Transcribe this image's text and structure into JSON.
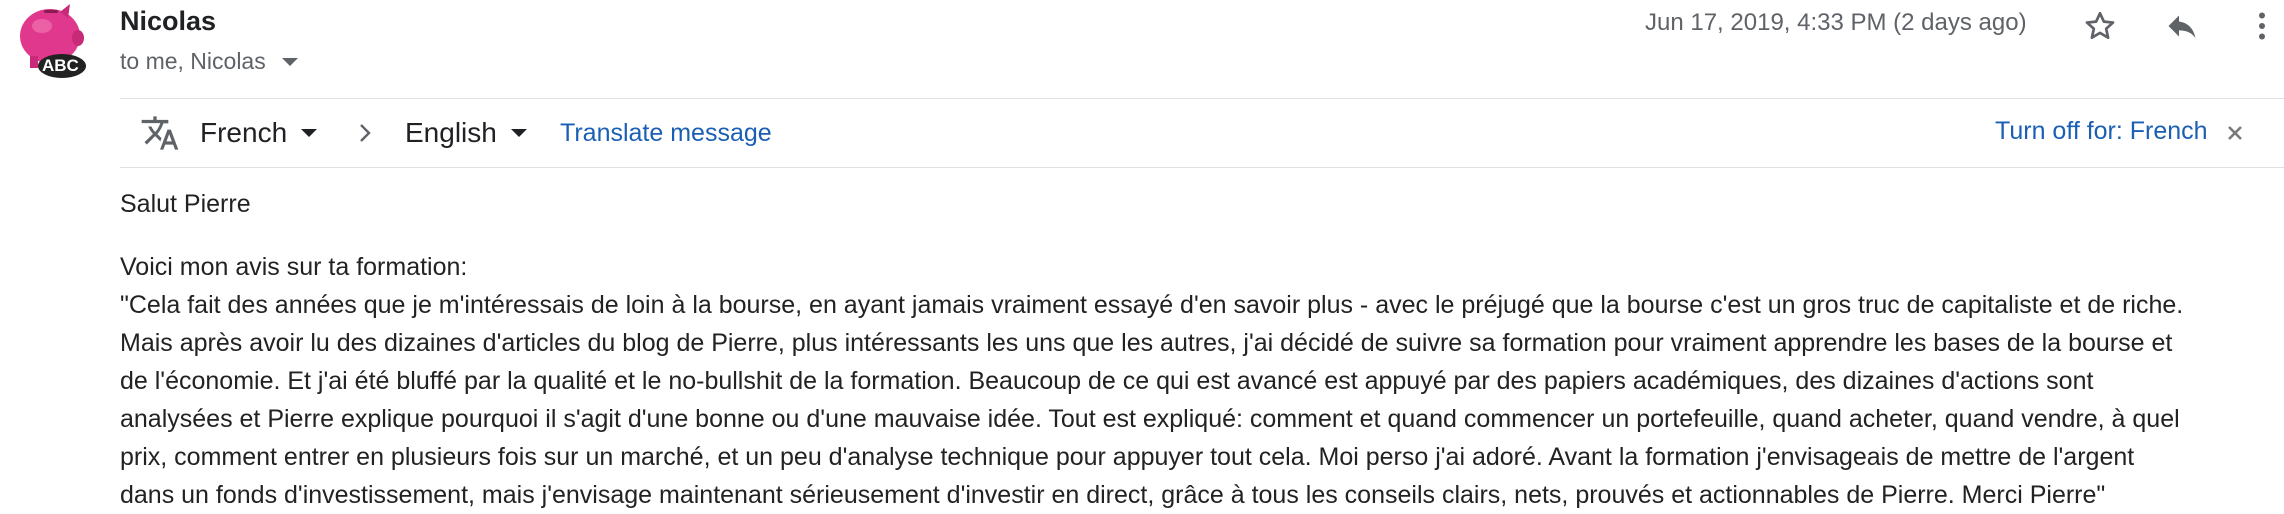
{
  "sender": {
    "name": "Nicolas",
    "avatar_text": "ABC",
    "recipients": "to me, Nicolas"
  },
  "header": {
    "date": "Jun 17, 2019, 4:33 PM (2 days ago)",
    "icons": [
      "star-icon",
      "reply-icon",
      "more-vert-icon"
    ]
  },
  "translate": {
    "icon": "translate-icon",
    "source_lang": "French",
    "target_lang": "English",
    "translate_link": "Translate message",
    "turn_off": "Turn off for: French",
    "link_color": "#1a5fb4"
  },
  "message": {
    "greeting": "Salut Pierre",
    "intro": "Voici mon avis sur ta formation:",
    "lines": [
      "\"Cela fait des années que je m'intéressais de loin à la bourse, en ayant jamais vraiment essayé d'en savoir plus - avec le préjugé que la bourse c'est un gros truc de capitaliste et de riche.",
      "Mais après avoir lu des dizaines d'articles du blog de Pierre, plus intéressants les uns que les autres, j'ai décidé de suivre sa formation pour vraiment apprendre les bases de la bourse et",
      "de l'économie. Et j'ai été bluffé par la qualité et le no-bullshit de la formation. Beaucoup de ce qui est avancé est appuyé par des papiers académiques, des dizaines d'actions sont",
      "analysées et Pierre explique pourquoi il s'agit d'une bonne ou d'une mauvaise idée. Tout est expliqué: comment et quand commencer un portefeuille, quand acheter, quand vendre, à quel",
      "prix, comment entrer en plusieurs fois sur un marché, et un peu d'analyse technique pour appuyer tout cela. Moi perso j'ai adoré. Avant la formation j'envisageais de mettre de l'argent",
      "dans un fonds d'investissement, mais j'envisage maintenant sérieusement d'investir en direct, grâce à tous les conseils clairs, nets, prouvés et actionnables de Pierre. Merci Pierre\""
    ]
  }
}
